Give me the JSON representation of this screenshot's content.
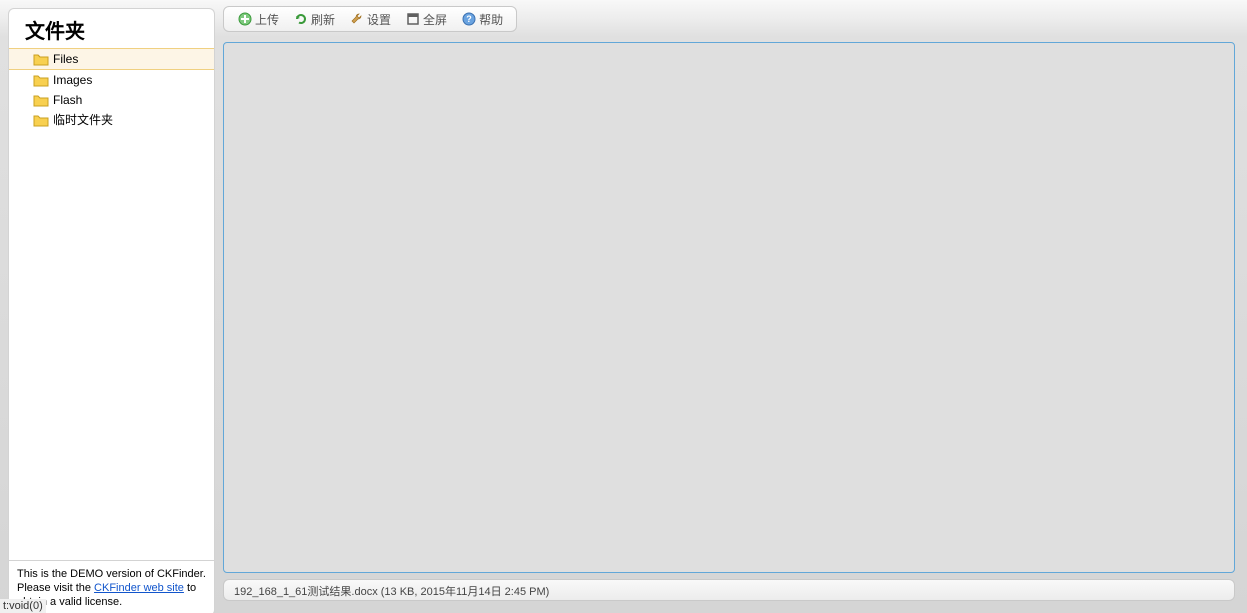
{
  "sidebar": {
    "title": "文件夹",
    "folders": [
      {
        "label": "Files",
        "selected": true
      },
      {
        "label": "Images",
        "selected": false
      },
      {
        "label": "Flash",
        "selected": false
      },
      {
        "label": "临时文件夹",
        "selected": false
      }
    ],
    "demo": {
      "p1": "This is the DEMO version of CKFinder. Please visit the ",
      "link": "CKFinder web site",
      "p2": " to obtain a valid license."
    }
  },
  "toolbar": {
    "upload": "上传",
    "refresh": "刷新",
    "settings": "设置",
    "fullscreen": "全屏",
    "help": "帮助"
  },
  "status": "192_168_1_61测试结果.docx (13 KB, 2015年11月14日 2:45 PM)",
  "browser_status": "t:void(0)"
}
